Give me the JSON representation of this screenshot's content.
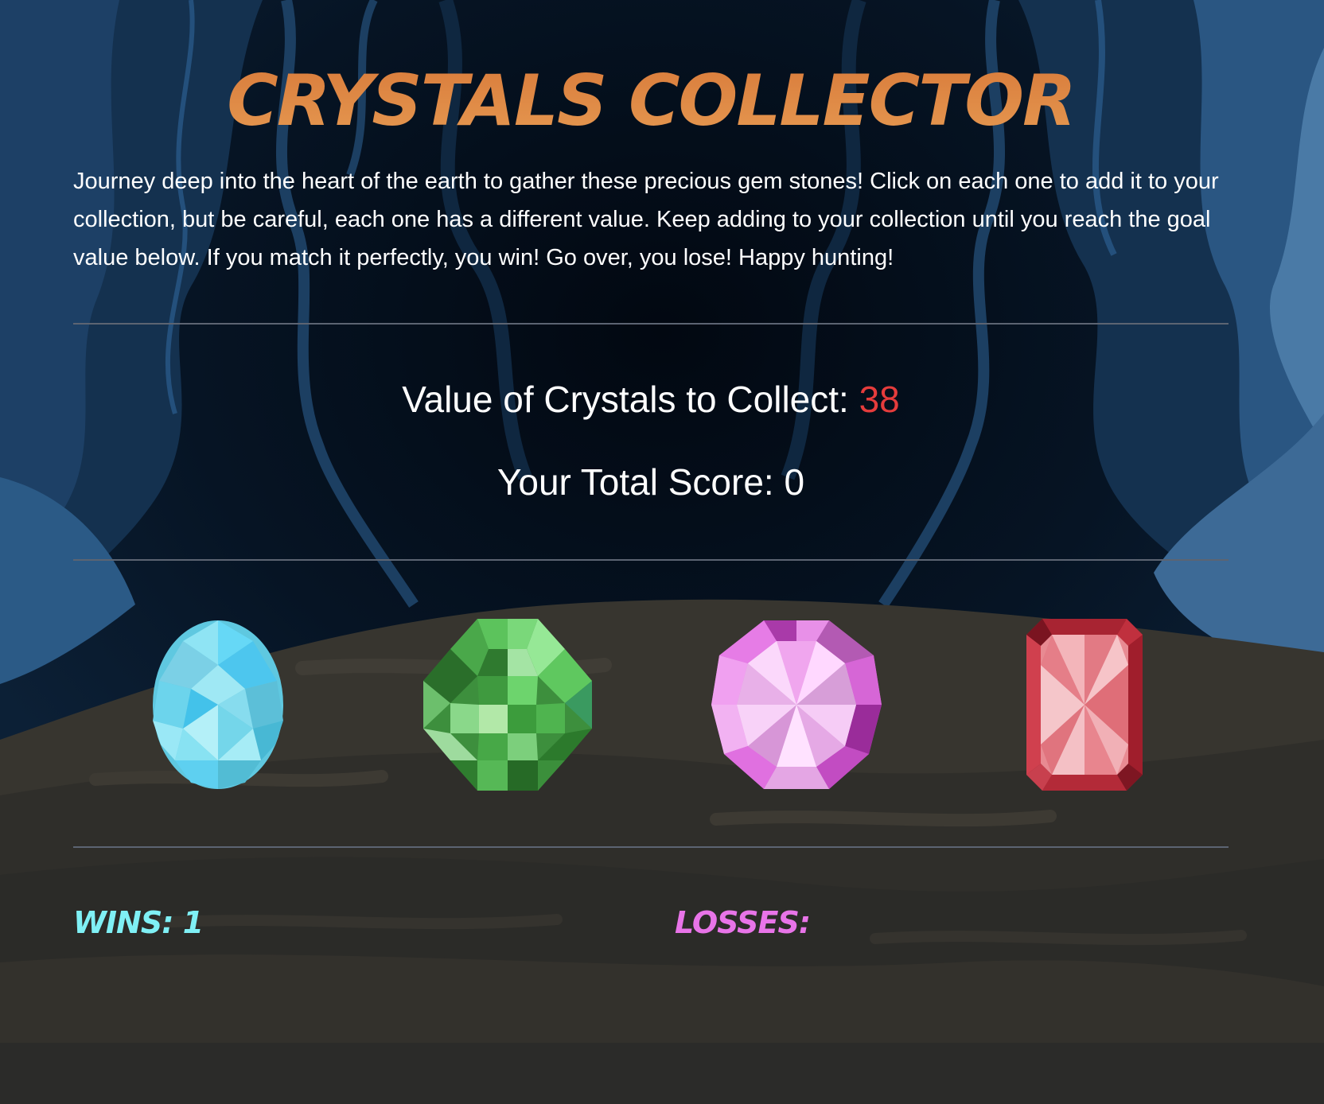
{
  "header": {
    "title": "CRYSTALS COLLECTOR",
    "intro": "Journey deep into the heart of the earth to gather these precious gem stones! Click on each one to add it to your collection, but be careful, each one has a different value. Keep adding to your collection until you reach the goal value below. If you match it perfectly, you win! Go over, you lose! Happy hunting!"
  },
  "game": {
    "goal_label": "Value of Crystals to Collect: ",
    "goal_value": "38",
    "score_label": "Your Total Score: ",
    "score_value": "0"
  },
  "crystals": [
    {
      "name": "blue-oval-crystal",
      "color": "#6fd8f0"
    },
    {
      "name": "green-square-crystal",
      "color": "#4fb34f"
    },
    {
      "name": "pink-round-crystal",
      "color": "#d95fd9"
    },
    {
      "name": "red-emerald-cut-crystal",
      "color": "#d43a48"
    }
  ],
  "stats": {
    "wins_label": "WINS: ",
    "wins_value": "1",
    "losses_label": "LOSSES:",
    "losses_value": ""
  },
  "colors": {
    "title_orange": "#e0873f",
    "goal_red": "#e53c3c",
    "wins_cyan": "#7ff0f5",
    "losses_pink": "#e874e8",
    "cave_dark": "#050c16",
    "cave_blue": "#1d3b5c",
    "floor_brown": "#37352f"
  }
}
